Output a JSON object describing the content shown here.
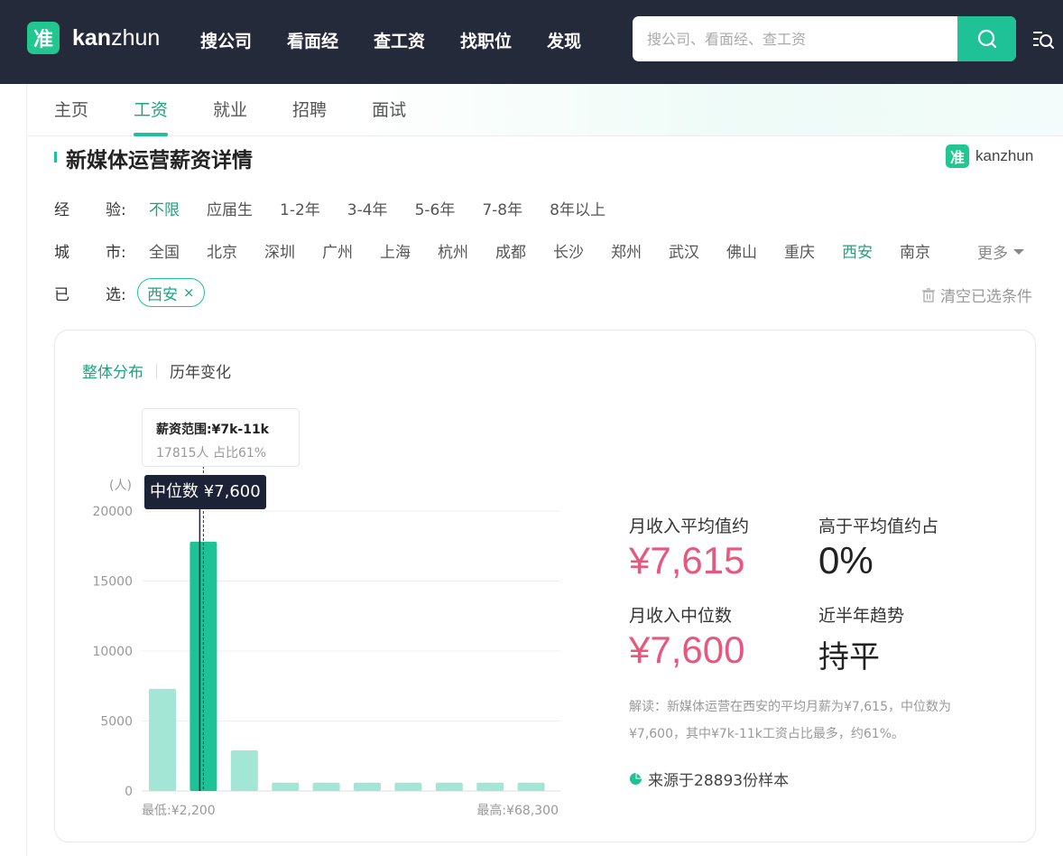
{
  "header": {
    "logo_mark": "准",
    "logo_text_bold": "kan",
    "logo_text_rest": "zhun",
    "nav": [
      "搜公司",
      "看面经",
      "查工资",
      "找职位",
      "发现"
    ],
    "search_placeholder": "搜公司、看面经、查工资"
  },
  "subnav": {
    "items": [
      "主页",
      "工资",
      "就业",
      "招聘",
      "面试"
    ],
    "active_index": 1
  },
  "page": {
    "title": "新媒体运营薪资详情",
    "brand_mark": "准",
    "brand_text": "kanzhun"
  },
  "filters": {
    "experience": {
      "label_a": "经",
      "label_b": "验:",
      "options": [
        "不限",
        "应届生",
        "1-2年",
        "3-4年",
        "5-6年",
        "7-8年",
        "8年以上"
      ],
      "selected": "不限"
    },
    "city": {
      "label_a": "城",
      "label_b": "市:",
      "options": [
        "全国",
        "北京",
        "深圳",
        "广州",
        "上海",
        "杭州",
        "成都",
        "长沙",
        "郑州",
        "武汉",
        "佛山",
        "重庆",
        "西安",
        "南京"
      ],
      "selected": "西安",
      "more": "更多"
    },
    "selected_row": {
      "label_a": "已",
      "label_b": "选:",
      "chip": "西安",
      "chip_close": "×",
      "clear": "清空已选条件"
    }
  },
  "card": {
    "tabs": [
      "整体分布",
      "历年变化"
    ],
    "active_tab": 0,
    "tooltip": {
      "title": "薪资范围:¥7k-11k",
      "sub": "17815人  占比61%"
    },
    "median_tag": "中位数 ¥7,600",
    "stats": {
      "avg_label": "月收入平均值约",
      "avg_value": "¥7,615",
      "above_label": "高于平均值约占",
      "above_value": "0%",
      "median_label": "月收入中位数",
      "median_value": "¥7,600",
      "trend_label": "近半年趋势",
      "trend_value": "持平"
    },
    "note": "解读：新媒体运营在西安的平均月薪为¥7,615，中位数为¥7,600，其中¥7k-11k工资占比最多，约61%。",
    "source": "来源于28893份样本"
  },
  "colors": {
    "accent": "#1fc296",
    "bar_light": "#a3e6d5",
    "highlight": "#e8577d",
    "header_bg": "#252a3a"
  },
  "chart_data": {
    "type": "bar",
    "y_unit": "(人)",
    "yticks": [
      0,
      5000,
      10000,
      15000,
      20000
    ],
    "ylim": [
      0,
      20000
    ],
    "values": [
      7300,
      17815,
      2900,
      600,
      600,
      600,
      600,
      600,
      600,
      600
    ],
    "highlight_index": 1,
    "median_marker": 7600,
    "xlabel_min": "最低:¥2,200",
    "xlabel_max": "最高:¥68,300",
    "grid": true
  }
}
